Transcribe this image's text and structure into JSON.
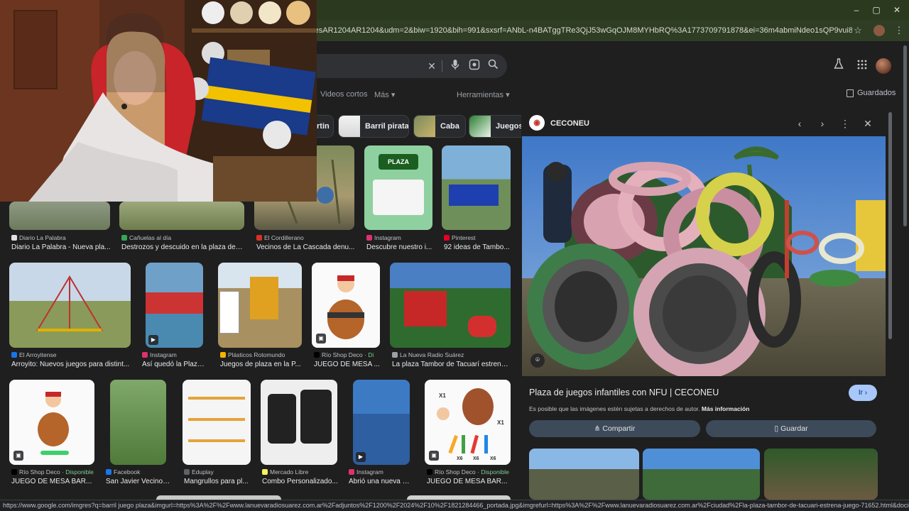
{
  "browser": {
    "url": "lFK_esAR1204AR1204&udm=2&biw=1920&bih=991&sxsrf=ANbL-n4BATggTRe3QjJ53wGqOJM8MYHbRQ%3A1773709791878&ei=36m4abmiNdeo1sQP9vui8Aw&ved=0ahUKEwj5j...",
    "window_controls": [
      "–",
      "▢",
      "✕"
    ],
    "status_url": "https://www.google.com/imgres?q=barril juego plaza&imgurl=https%3A%2F%2Fwww.lanuevaradiosuarez.com.ar%2Fadjuntos%2F1200%2F2024%2F10%2F1821284466_portada.jpg&imgrefurl=https%3A%2F%2Fwww.lanuevaradiosuarez.com.ar%2Fciudad%2Fla-plaza-tambor-de-tacuari-estrena-juego-71652.html&docid=JgyCG04Wy2sgaM&tbnid=Dbl7..."
  },
  "search": {
    "tabs": [
      "Videos cortos",
      "Más ▾"
    ],
    "tools_label": "Herramientas ▾",
    "saved_label": "Guardados",
    "chips": [
      "rtin",
      "Barril pirata",
      "Caba",
      "Juegos"
    ]
  },
  "results": {
    "row1": [
      {
        "source": "Diario La Palabra",
        "title": "Diario La Palabra - Nueva pla..."
      },
      {
        "source": "Cañuelas al día",
        "title": "Destrozos y descuido en la plaza del ..."
      },
      {
        "source": "El Cordillerano",
        "title": "Vecinos de La Cascada denu..."
      },
      {
        "source": "Instagram",
        "title": "Descubre nuestro i..."
      },
      {
        "source": "Pinterest",
        "title": "92 ideas de Tambo..."
      }
    ],
    "row2": [
      {
        "source": "El Arroyitense",
        "title": "Arroyito: Nuevos juegos para distint..."
      },
      {
        "source": "Instagram",
        "title": "Así quedó la Plaza..."
      },
      {
        "source": "Plásticos Rotomundo",
        "title": "Juegos de plaza en la P..."
      },
      {
        "source": "Río Shop Deco",
        "availability": "Di",
        "title": "JUEGO DE MESA ..."
      },
      {
        "source": "La Nueva Radio Suárez",
        "title": "La plaza Tambor de Tacuarí estrena ..."
      }
    ],
    "row3": [
      {
        "source": "Río Shop Deco",
        "availability": "Disponible",
        "title": "JUEGO DE MESA BAR..."
      },
      {
        "source": "Facebook",
        "title": "San Javier Vecinos..."
      },
      {
        "source": "Eduplay",
        "title": "Mangrullos para pl..."
      },
      {
        "source": "Mercado Libre",
        "title": "Combo Personalizado..."
      },
      {
        "source": "Instagram",
        "title": "Abrió una nueva pl..."
      },
      {
        "source": "Río Shop Deco",
        "availability": "Disponible",
        "title": "JUEGO DE MESA BAR..."
      }
    ]
  },
  "panel": {
    "source": "CECONEU",
    "title": "Plaza de juegos infantiles con NFU | CECONEU",
    "copyright": "Es posible que las imágenes estén sujetas a derechos de autor.",
    "more_info": "Más información",
    "go_label": "Ir ›",
    "share_label": "Compartir",
    "save_label": "Guardar"
  },
  "labels": {
    "plaza_card": "PLAZA",
    "x1": "X1",
    "x6": "X6"
  }
}
